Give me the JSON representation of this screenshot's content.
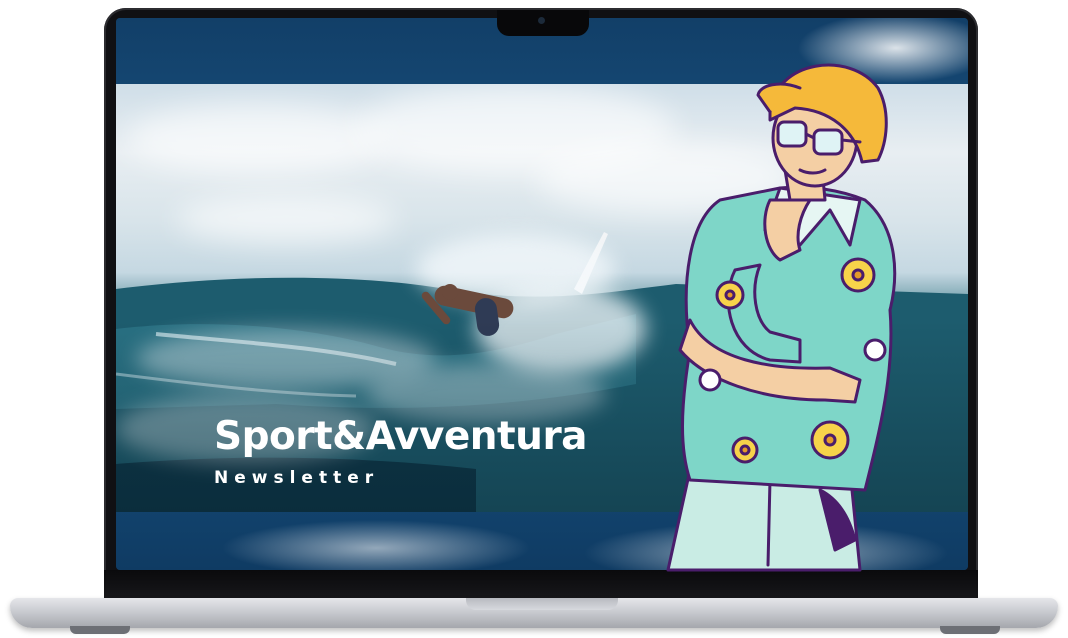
{
  "newsletter": {
    "title": "Sport&Avventura",
    "subtitle": "Newsletter"
  },
  "illustration": {
    "subject": "surfer riding a wave",
    "character": "cartoon man with glasses, yellow cap and floral shirt"
  },
  "icons": [
    "camera-icon"
  ],
  "colors": {
    "title_text": "#ffffff",
    "bezel": "#101013",
    "ocean": "#134a5c",
    "cap": "#f5b93a",
    "shirt": "#7ed6c8",
    "flower": "#f7d34a",
    "outline": "#4a1d6b"
  }
}
